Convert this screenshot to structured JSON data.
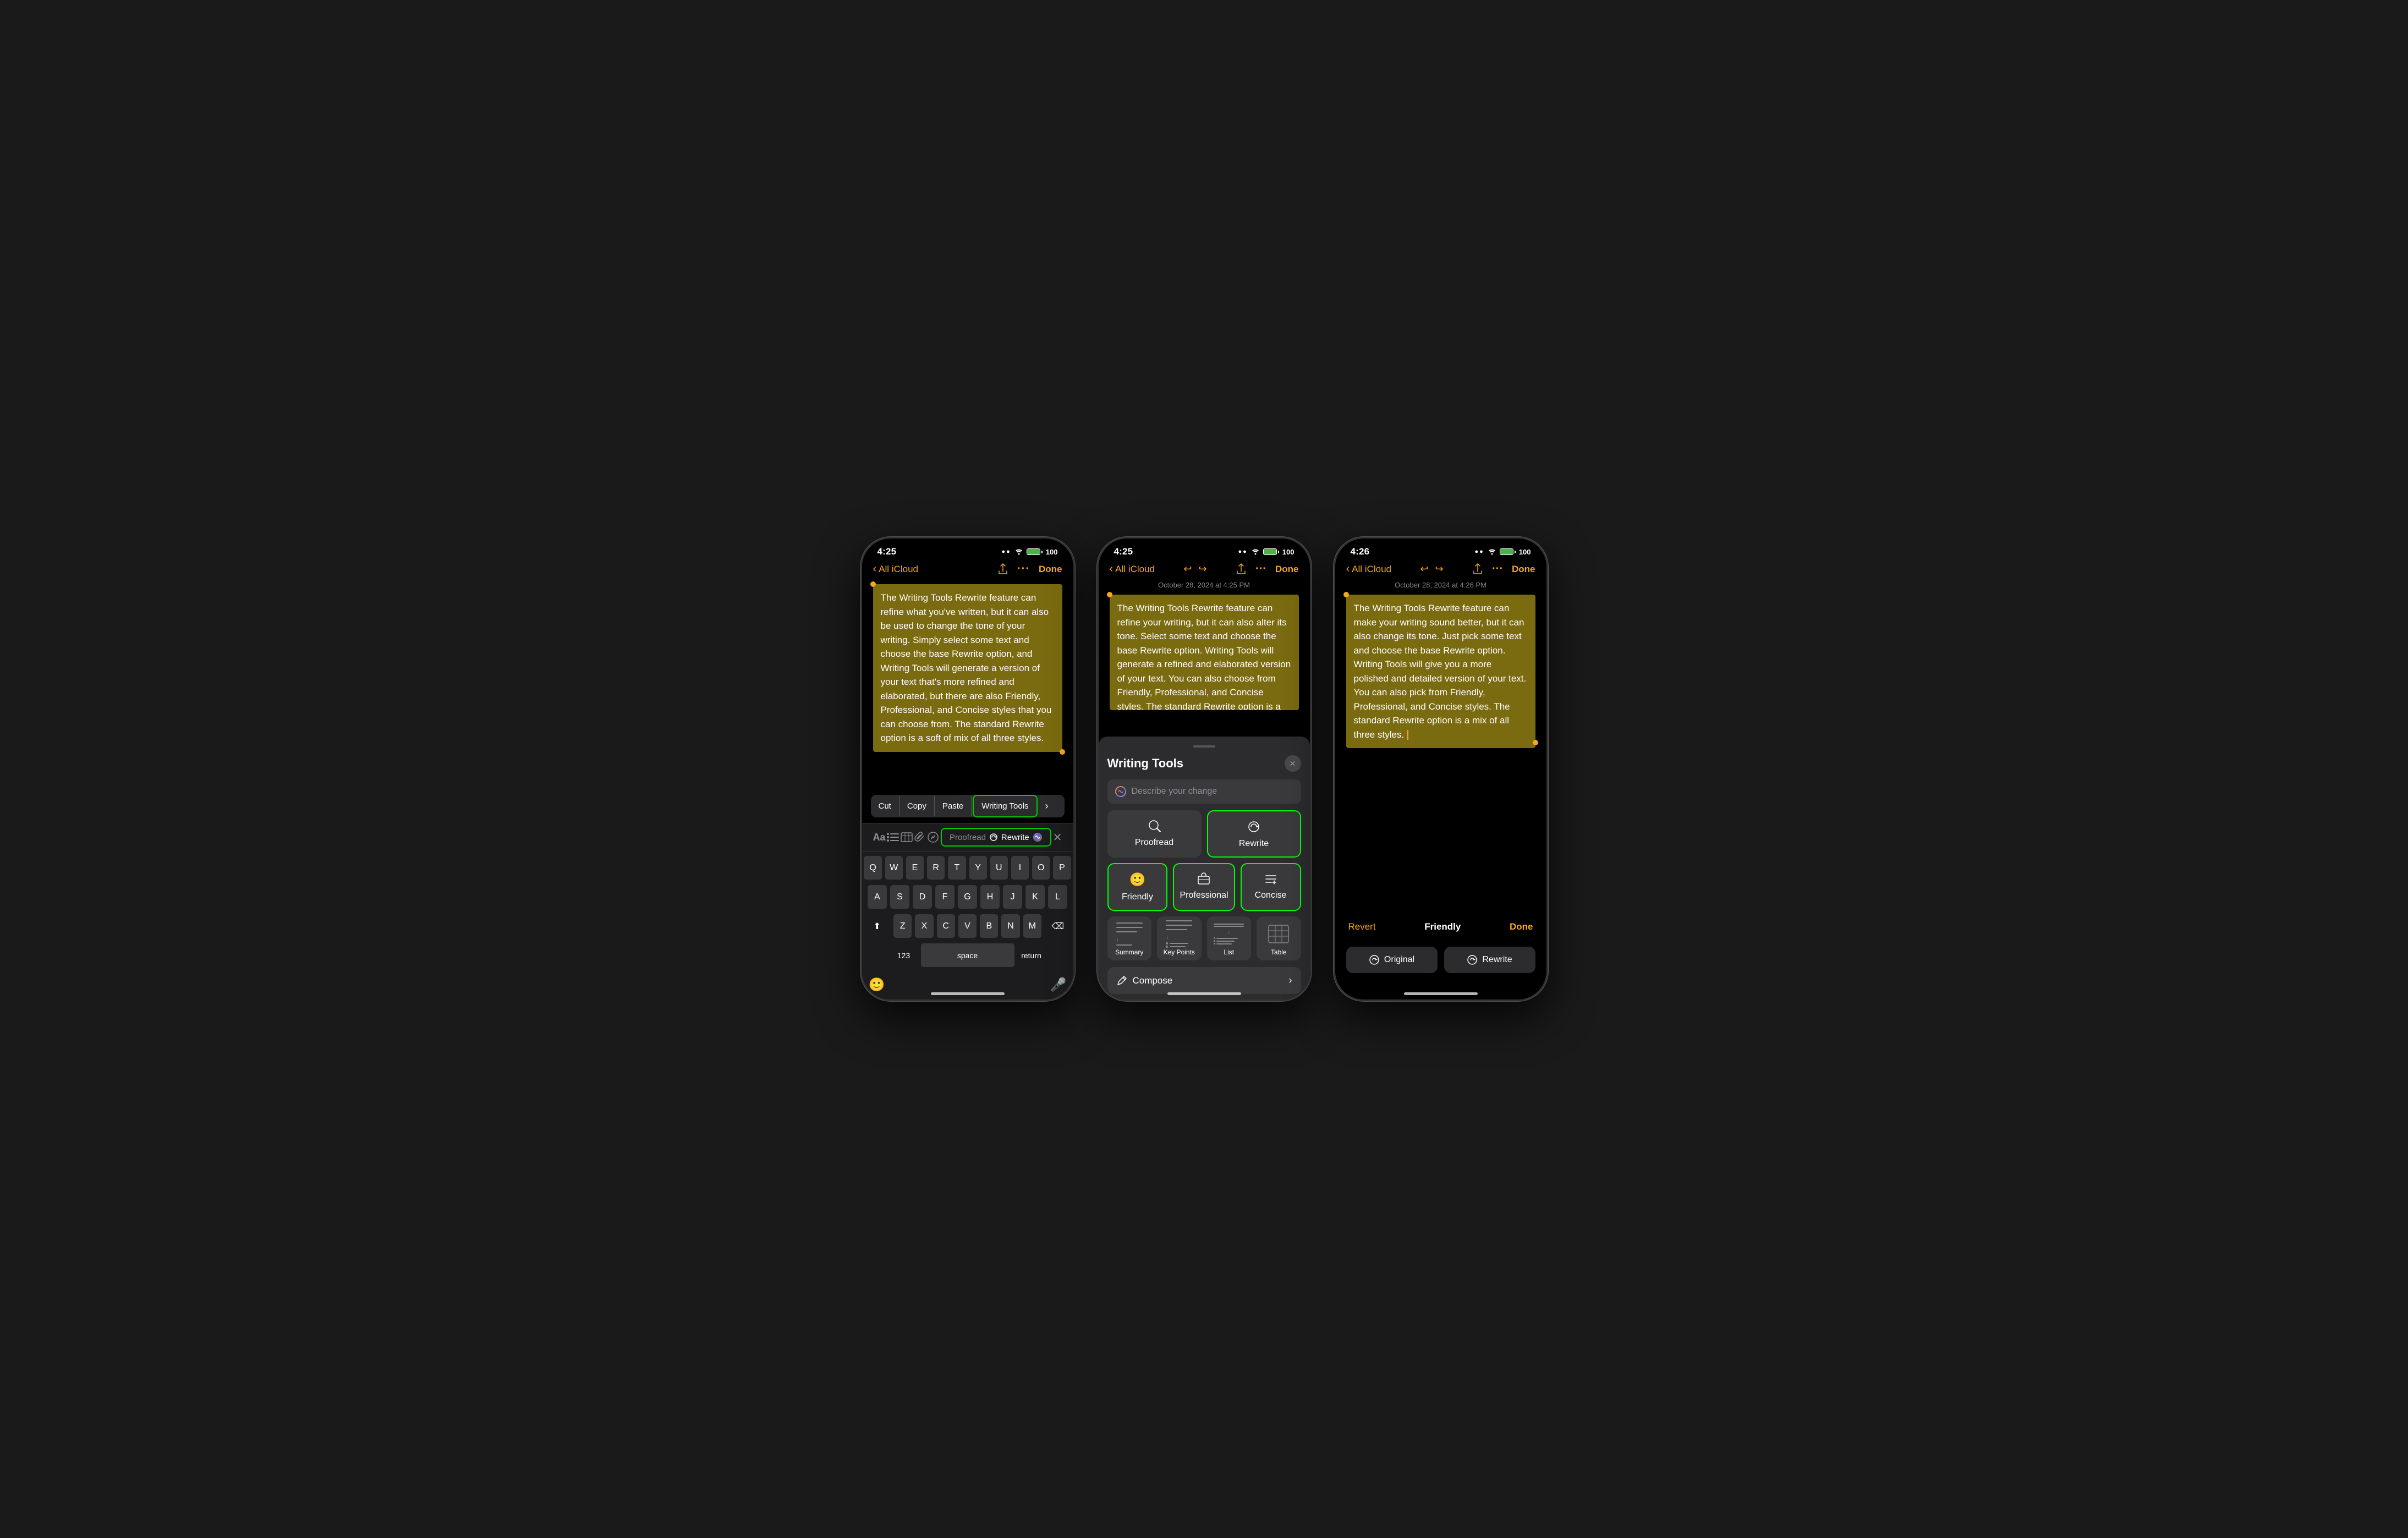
{
  "phones": [
    {
      "id": "phone1",
      "status_bar": {
        "time": "4:25",
        "signal_dots": "····",
        "wifi": "WiFi",
        "battery": "100"
      },
      "nav": {
        "back_label": "All iCloud",
        "share_icon": "share",
        "more_icon": "···",
        "done_label": "Done"
      },
      "text_content": "The Writing Tools Rewrite feature can refine what you've written, but it can also be used to change the tone of your writing. Simply select some text and choose the base Rewrite option, and Writing Tools will generate a version of your text that's more refined and elaborated, but there are also Friendly, Professional, and Concise styles that you can choose from. The standard Rewrite option is a soft of mix of all three styles.",
      "context_menu": {
        "items": [
          "Cut",
          "Copy",
          "Paste",
          "Writing Tools"
        ],
        "highlighted": "Writing Tools",
        "arrow": "›"
      },
      "toolbar": {
        "proofread": "Proofread",
        "rewrite": "Rewrite"
      },
      "keyboard": {
        "rows": [
          [
            "Q",
            "W",
            "E",
            "R",
            "T",
            "Y",
            "U",
            "I",
            "O",
            "P"
          ],
          [
            "A",
            "S",
            "D",
            "F",
            "G",
            "H",
            "J",
            "K",
            "L"
          ],
          [
            "⇧",
            "Z",
            "X",
            "C",
            "V",
            "B",
            "N",
            "M",
            "⌫"
          ],
          [
            "123",
            "space",
            "return"
          ]
        ]
      },
      "bottom_icons": {
        "emoji": "😊",
        "mic": "🎤"
      }
    },
    {
      "id": "phone2",
      "status_bar": {
        "time": "4:25",
        "signal_dots": "····",
        "wifi": "WiFi",
        "battery": "100"
      },
      "nav": {
        "back_label": "All iCloud",
        "undo_icon": "↩",
        "redo_icon": "↪",
        "share_icon": "share",
        "more_icon": "···",
        "done_label": "Done"
      },
      "date_label": "October 28, 2024 at 4:25 PM",
      "text_content": "The Writing Tools Rewrite feature can refine your writing, but it can also alter its tone. Select some text and choose the base Rewrite option. Writing Tools will generate a refined and elaborated version of your text. You can also choose from Friendly, Professional, and Concise styles. The standard Rewrite option is a combination of all three styles.",
      "sheet": {
        "title": "Writing Tools",
        "describe_placeholder": "Describe your change",
        "tools": {
          "proofread": "Proofread",
          "rewrite": "Rewrite",
          "friendly": "Friendly",
          "professional": "Professional",
          "concise": "Concise",
          "summary": "Summary",
          "key_points": "Key Points",
          "list": "List",
          "table": "Table"
        },
        "compose_label": "Compose"
      }
    },
    {
      "id": "phone3",
      "status_bar": {
        "time": "4:26",
        "signal_dots": "····",
        "wifi": "WiFi",
        "battery": "100"
      },
      "nav": {
        "back_label": "All iCloud",
        "undo_icon": "↩",
        "redo_icon": "↪",
        "share_icon": "share",
        "more_icon": "···",
        "done_label": "Done"
      },
      "date_label": "October 28, 2024 at 4:26 PM",
      "text_content": "The Writing Tools Rewrite feature can make your writing sound better, but it can also change its tone. Just pick some text and choose the base Rewrite option. Writing Tools will give you a more polished and detailed version of your text. You can also pick from Friendly, Professional, and Concise styles. The standard Rewrite option is a mix of all three styles.",
      "bottom_bar": {
        "revert": "Revert",
        "title": "Friendly",
        "done": "Done",
        "original_btn": "Original",
        "rewrite_btn": "Rewrite"
      }
    }
  ]
}
